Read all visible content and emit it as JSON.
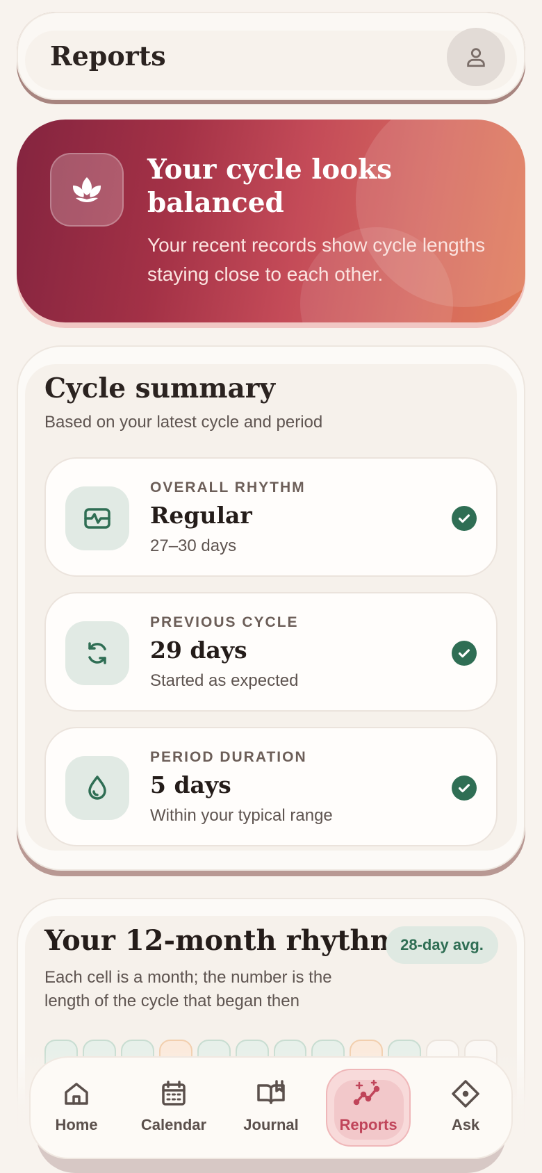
{
  "header": {
    "title": "Reports",
    "avatar_icon": "user-icon"
  },
  "hero": {
    "icon": "lotus-icon",
    "title": "Your cycle looks balanced",
    "text": "Your recent records show cycle lengths staying close to each other."
  },
  "summary": {
    "title": "Cycle summary",
    "subtitle": "Based on your latest cycle and period",
    "items": [
      {
        "icon": "rhythm-icon",
        "label": "OVERALL RHYTHM",
        "value": "Regular",
        "desc": "27–30 days",
        "status_icon": "check-icon"
      },
      {
        "icon": "cycle-refresh-icon",
        "label": "PREVIOUS CYCLE",
        "value": "29 days",
        "desc": "Started as expected",
        "status_icon": "check-icon"
      },
      {
        "icon": "drop-icon",
        "label": "PERIOD DURATION",
        "value": "5 days",
        "desc": "Within your typical range",
        "status_icon": "check-icon"
      }
    ]
  },
  "rhythm": {
    "title": "Your 12-month rhythm",
    "badge": "28-day avg.",
    "subtitle": "Each cell is a month; the number is the length of the cycle that began then",
    "cells": [
      "normal",
      "normal",
      "normal",
      "warm",
      "normal",
      "normal",
      "normal",
      "normal",
      "warm",
      "normal",
      "empty",
      "empty"
    ]
  },
  "nav": {
    "items": [
      {
        "label": "Home",
        "icon": "home-icon",
        "active": false
      },
      {
        "label": "Calendar",
        "icon": "calendar-icon",
        "active": false
      },
      {
        "label": "Journal",
        "icon": "book-icon",
        "active": false
      },
      {
        "label": "Reports",
        "icon": "trend-icon",
        "active": true
      },
      {
        "label": "Ask",
        "icon": "diamond-icon",
        "active": false
      }
    ]
  },
  "colors": {
    "accent": "#c0455a",
    "green": "#2f6e54",
    "background": "#f8f3ee"
  }
}
